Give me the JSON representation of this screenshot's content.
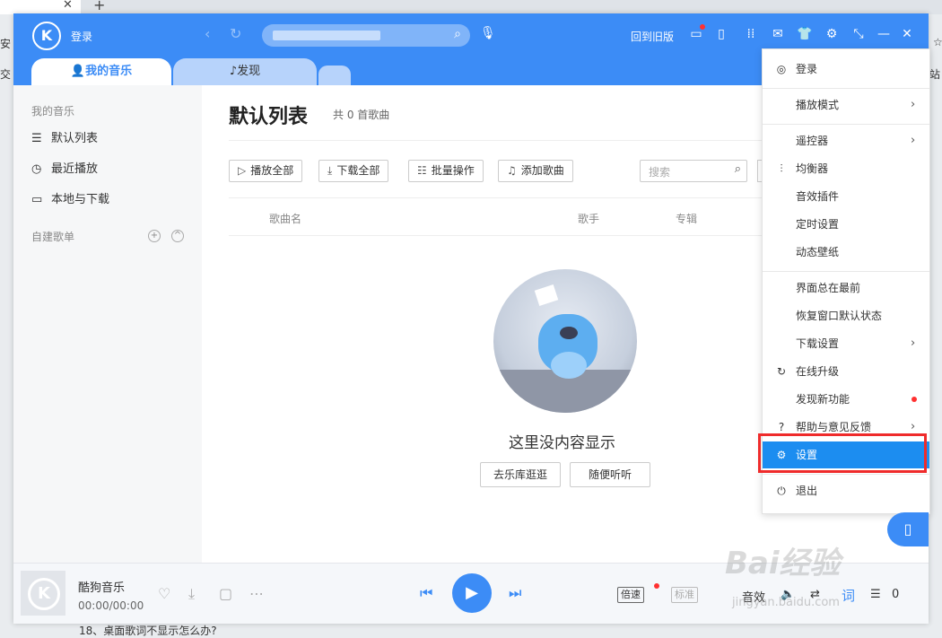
{
  "browser": {
    "left_text_1": "安",
    "left_text_2": "交",
    "right_text_1": "☆",
    "right_text_2": "站",
    "bottom_caption": "18、桌面歌词不显示怎么办?",
    "watermark": "Bai经验",
    "watermark_sub": "jingyan.baidu.com"
  },
  "header": {
    "logo_letter": "K",
    "login": "登录",
    "back_to_old": "回到旧版"
  },
  "tabs": [
    {
      "label": "我的音乐"
    },
    {
      "label": "发现"
    }
  ],
  "sidebar": {
    "my_music_heading": "我的音乐",
    "items": [
      {
        "label": "默认列表"
      },
      {
        "label": "最近播放"
      },
      {
        "label": "本地与下载"
      }
    ],
    "custom_heading": "自建歌单"
  },
  "main": {
    "title": "默认列表",
    "count": "共 0 首歌曲",
    "toolbar": {
      "play_all": "播放全部",
      "download_all": "下载全部",
      "batch": "批量操作",
      "add_song": "添加歌曲"
    },
    "search_placeholder": "搜索",
    "columns": {
      "song": "歌曲名",
      "singer": "歌手",
      "album": "专辑"
    },
    "empty_text": "这里没内容显示",
    "btn_browse": "去乐库逛逛",
    "btn_random": "随便听听"
  },
  "player": {
    "song": "酷狗音乐",
    "time": "00:00/00:00",
    "speed": "倍速",
    "quality": "标准",
    "effect": "音效",
    "lyrics": "词",
    "queue_count": "0"
  },
  "menu": {
    "items": [
      {
        "label": "登录"
      },
      {
        "label": "播放模式"
      },
      {
        "label": "遥控器"
      },
      {
        "label": "均衡器"
      },
      {
        "label": "音效插件"
      },
      {
        "label": "定时设置"
      },
      {
        "label": "动态壁纸"
      },
      {
        "label": "界面总在最前"
      },
      {
        "label": "恢复窗口默认状态"
      },
      {
        "label": "下载设置"
      },
      {
        "label": "在线升级"
      },
      {
        "label": "发现新功能"
      },
      {
        "label": "帮助与意见反馈"
      },
      {
        "label": "设置"
      },
      {
        "label": "退出"
      }
    ]
  },
  "colors": {
    "brand_blue": "#3c8cf6",
    "menu_selected": "#1c8df0",
    "highlight_red": "#ef2b2b"
  }
}
